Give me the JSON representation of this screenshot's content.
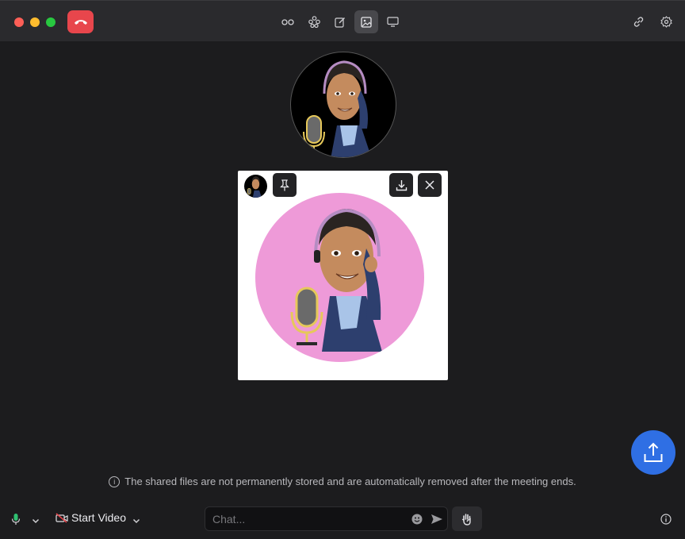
{
  "window": {
    "toolbar_icons": [
      "two-circles-icon",
      "apps-icon",
      "compose-icon",
      "image-icon",
      "screen-icon"
    ],
    "active_tool": "image-icon",
    "right_icons": [
      "link-icon",
      "gear-icon"
    ]
  },
  "shared_image": {
    "actions": [
      "pin-icon",
      "download-icon",
      "close-icon"
    ]
  },
  "notice": {
    "text": "The shared files are not permanently stored and are automatically removed after the meeting ends."
  },
  "bottom": {
    "start_video_label": "Start Video",
    "chat_placeholder": "Chat...",
    "chat_value": ""
  },
  "colors": {
    "accent": "#2f6fe4",
    "hangup": "#e8464c",
    "avatar_bg": "#ee9ad8"
  }
}
